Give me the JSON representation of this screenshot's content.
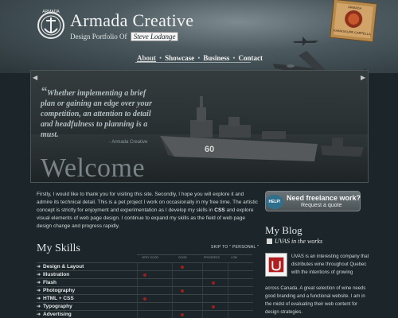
{
  "header": {
    "emblem_text": "ARMADA",
    "title": "Armada Creative",
    "tagline_prefix": "Design Portfolio Of",
    "tagline_name": "Steve Lodange",
    "stamp_label": "KAMASAUPE CAPPELLA",
    "stamp_sub": "ARMADA"
  },
  "nav": {
    "items": [
      "About",
      "Showcase",
      "Business",
      "Contact"
    ],
    "separator": "•",
    "active_index": 0
  },
  "hero": {
    "quote": "Whether implementing a brief plan or gaining an edge over your competition, an attention to detail and headfulness to planning is a must.",
    "quote_author": "- Armada Creative",
    "welcome": "Welcome",
    "ship_number": "60",
    "prev_arrow": "◀",
    "next_arrow": "▶"
  },
  "intro": {
    "part1": "Firstly, I would like to thank you for visiting this site. Secondly, I hope you will explore it and admire its technical detail. This is a pet project I work on occasionally in my free time. The artistic concept is strictly for enjoyment and experimentation as I develop my skills in ",
    "hl": "CSS",
    "part2": " and explore visual elements of web page design. I continue to expand my skills as the field of web page design change and progress rapidly."
  },
  "freelance": {
    "badge": "HELP!",
    "title": "Need freelance work?",
    "subtitle": "Request a quote"
  },
  "skills": {
    "title": "My Skills",
    "skip_label": "SKIP TO \" PERSONAL \"",
    "columns": [
      "VERY GOOD",
      "GOOD",
      "PROGRESS",
      "LOW"
    ],
    "items": [
      {
        "name": "Design & Layout",
        "level": 1
      },
      {
        "name": "Illustration",
        "level": 0
      },
      {
        "name": "Flash",
        "level": 2
      },
      {
        "name": "Photography",
        "level": 1
      },
      {
        "name": "HTML + CSS",
        "level": 0
      },
      {
        "name": "Typography",
        "level": 2
      },
      {
        "name": "Advertising",
        "level": 1
      }
    ],
    "row_arrow": "➜",
    "dot_color": "#9e1d1d"
  },
  "blog": {
    "title": "My Blog",
    "post_title": "UVAS in the works",
    "text_side": "UVAS is an interesting company that distributes wine throughout Quebec with the intentions of growing",
    "text_full": "across Canada. A great selection of wine needs good branding and a functional website. I am in the midst of evaluating their web content for design strategies."
  },
  "colors": {
    "background": "#1c2529",
    "accent_red": "#9e1d1d",
    "help_blue": "#2f6f8c"
  }
}
